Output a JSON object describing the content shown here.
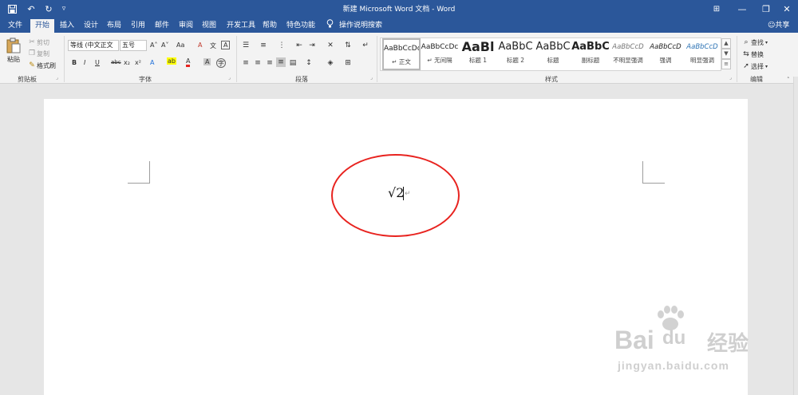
{
  "window": {
    "title": "新建 Microsoft Word 文档 - Word",
    "qa_undo": "↶",
    "qa_redo": "↻",
    "qa_more": "▿",
    "save_icon": "save-icon",
    "min": "—",
    "restore": "❐",
    "close": "✕",
    "ribbon_opts": "⊞"
  },
  "tabs": [
    "文件",
    "开始",
    "插入",
    "设计",
    "布局",
    "引用",
    "邮件",
    "审阅",
    "视图",
    "开发工具",
    "帮助",
    "特色功能"
  ],
  "active_tab": "开始",
  "tell_me": "操作说明搜索",
  "share": "共享",
  "clipboard": {
    "paste": "粘贴",
    "cut": "剪切",
    "copy": "复制",
    "format_painter": "格式刷",
    "label": "剪贴板"
  },
  "font": {
    "name": "等线 (中文正文",
    "size": "五号",
    "grow": "A˄",
    "shrink": "A˅",
    "case": "Aa",
    "clear": "A",
    "phonetic": "文",
    "border_char": "A",
    "bold": "B",
    "italic": "I",
    "underline": "U",
    "strike": "abc",
    "subscript": "x₂",
    "superscript": "x²",
    "effects": "A",
    "highlight": "ab",
    "color": "A",
    "shade": "A",
    "enclose": "字",
    "label": "字体"
  },
  "paragraph": {
    "label": "段落"
  },
  "styles": {
    "label": "样式",
    "items": [
      {
        "sample": "AaBbCcDc",
        "name": "↵ 正文"
      },
      {
        "sample": "AaBbCcDc",
        "name": "↵ 无间隔"
      },
      {
        "sample": "AaBl",
        "name": "标题 1"
      },
      {
        "sample": "AaBbC",
        "name": "标题 2"
      },
      {
        "sample": "AaBbC",
        "name": "标题"
      },
      {
        "sample": "AaBbC",
        "name": "副标题"
      },
      {
        "sample": "AaBbCcD",
        "name": "不明显强调"
      },
      {
        "sample": "AaBbCcD",
        "name": "强调"
      },
      {
        "sample": "AaBbCcD",
        "name": "明显强调"
      }
    ]
  },
  "editing": {
    "find": "查找",
    "replace": "替换",
    "select": "选择",
    "label": "编辑"
  },
  "document": {
    "equation": "√2",
    "para_mark": "↵"
  },
  "watermark": {
    "brand": "Bai",
    "brand2": "du",
    "cn": "经验",
    "url": "jingyan.baidu.com"
  },
  "colors": {
    "accent": "#2b579a",
    "highlight": "#e8231f"
  }
}
